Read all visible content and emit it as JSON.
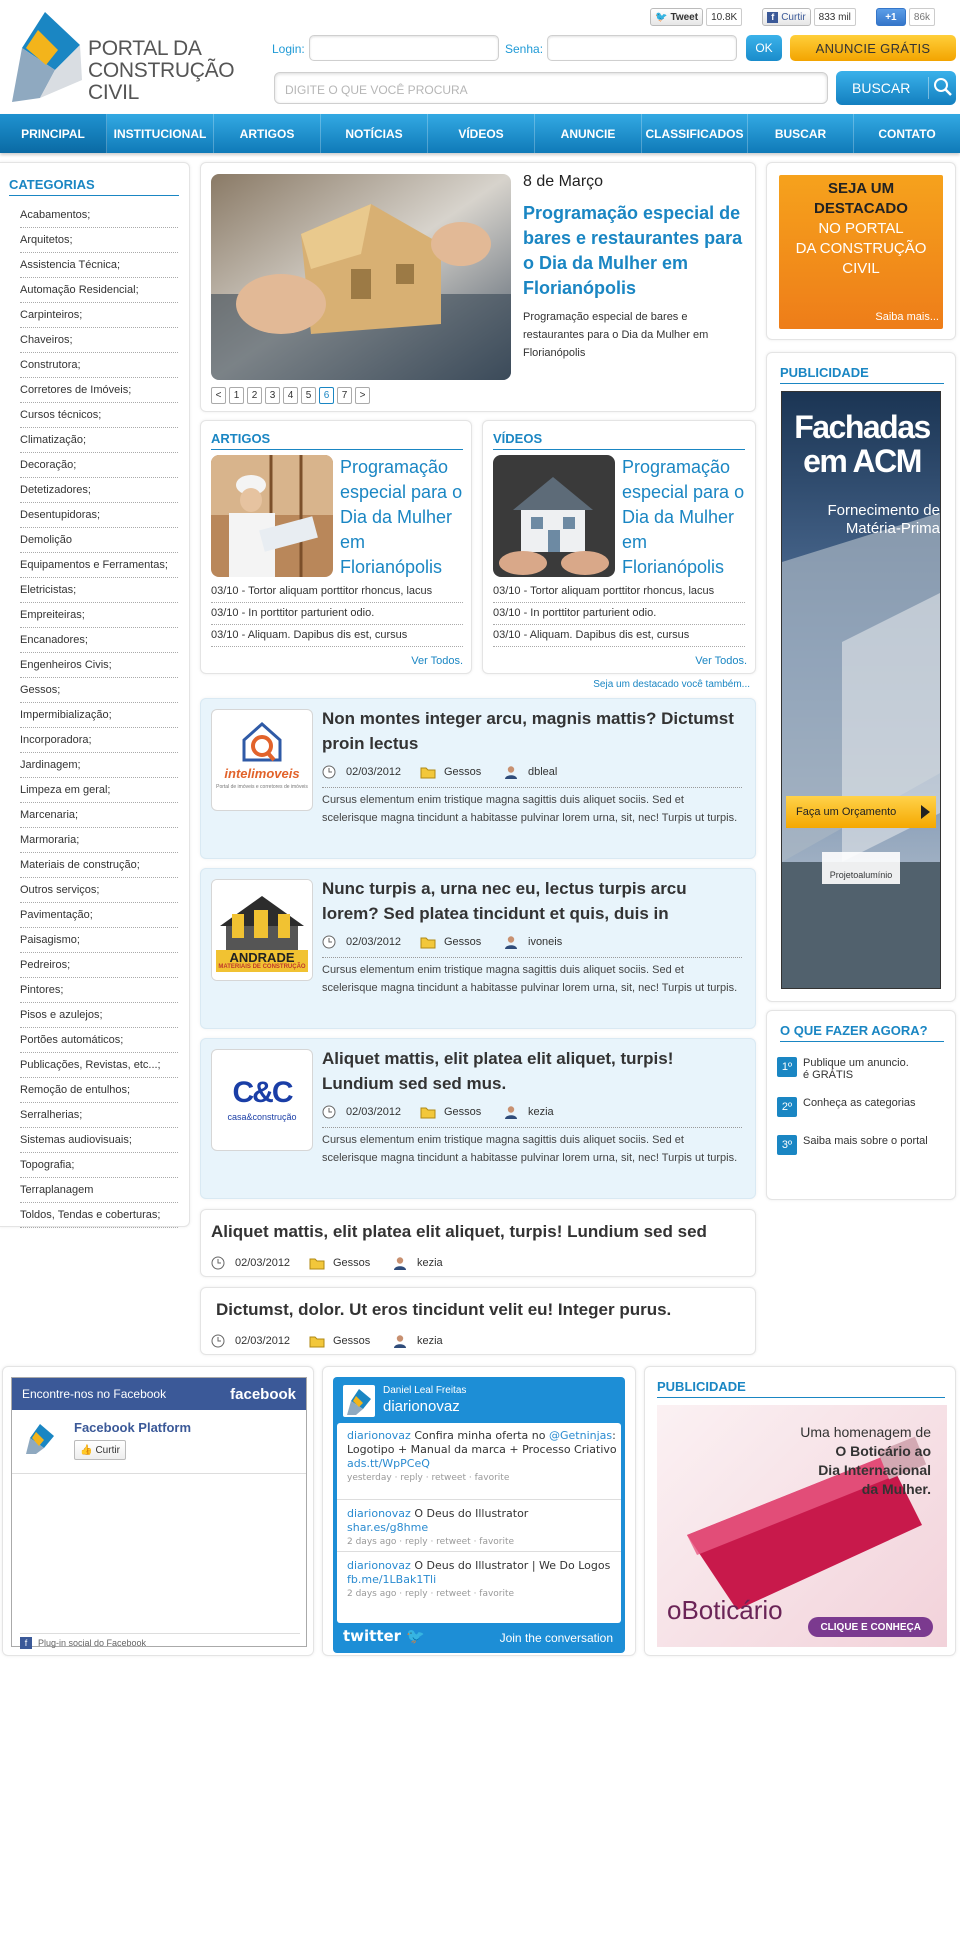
{
  "brand": {
    "logo_line1": "PORTAL DA",
    "logo_line2": "CONSTRUÇÃO CIVIL"
  },
  "social": {
    "tweet_label": "Tweet",
    "tweet_count": "10.8K",
    "curtir_label": "Curtir",
    "curtir_count": "833 mil",
    "plusone_label": "+1",
    "plusone_count": "86k"
  },
  "header": {
    "login_label": "Login:",
    "senha_label": "Senha:",
    "ok_label": "OK",
    "anuncie_label": "ANUNCIE GRÁTIS",
    "search_placeholder": "DIGITE O QUE VOCÊ PROCURA",
    "search_button": "BUSCAR"
  },
  "nav": [
    "PRINCIPAL",
    "INSTITUCIONAL",
    "ARTIGOS",
    "NOTÍCIAS",
    "VÍDEOS",
    "ANUNCIE",
    "CLASSIFICADOS",
    "BUSCAR",
    "CONTATO"
  ],
  "categories": {
    "title": "CATEGORIAS",
    "items": [
      "Acabamentos;",
      "Arquitetos;",
      "Assistencia Técnica;",
      "Automação Residencial;",
      "Carpinteiros;",
      "Chaveiros;",
      "Construtora;",
      "Corretores de Imóveis;",
      "Cursos técnicos;",
      "Climatização;",
      "Decoração;",
      "Detetizadores;",
      "Desentupidoras;",
      "Demolição",
      "Equipamentos e Ferramentas;",
      "Eletricistas;",
      "Empreiteiras;",
      "Encanadores;",
      "Engenheiros Civis;",
      "Gessos;",
      "Impermibialização;",
      "Incorporadora;",
      "Jardinagem;",
      "Limpeza em geral;",
      "Marcenaria;",
      "Marmoraria;",
      "Materiais de construção;",
      "Outros serviços;",
      "Pavimentação;",
      "Paisagismo;",
      "Pedreiros;",
      "Pintores;",
      "Pisos e azulejos;",
      "Portões automáticos;",
      "Publicações, Revistas, etc...;",
      "Remoção de entulhos;",
      "Serralherias;",
      "Sistemas audiovisuais;",
      "Topografia;",
      "Terraplanagem",
      "Toldos, Tendas e coberturas;"
    ]
  },
  "featured": {
    "date": "8 de Março",
    "title": "Programação especial de bares e restaurantes para o Dia da Mulher em Florianópolis",
    "summary": "Programação especial de bares e restaurantes para o Dia da Mulher em Florianópolis",
    "pages": [
      "<",
      "1",
      "2",
      "3",
      "4",
      "5",
      "6",
      "7",
      ">"
    ],
    "current_page": "6"
  },
  "artigos": {
    "title": "ARTIGOS",
    "headline": "Programação especial para o Dia da Mulher em Florianópolis",
    "items": [
      "03/10 - Tortor aliquam porttitor rhoncus, lacus",
      "03/10 - In porttitor parturient odio.",
      "03/10 - Aliquam. Dapibus dis est, cursus"
    ],
    "more": "Ver Todos."
  },
  "videos": {
    "title": "VÍDEOS",
    "headline": "Programação especial para o Dia da Mulher em Florianópolis",
    "items": [
      "03/10 - Tortor aliquam porttitor rhoncus, lacus",
      "03/10 - In porttitor parturient odio.",
      "03/10 - Aliquam. Dapibus dis est, cursus"
    ],
    "more": "Ver Todos."
  },
  "destacado_link": "Seja um destacado você também...",
  "posts": [
    {
      "title": "Non montes integer arcu, magnis mattis? Dictumst proin lectus",
      "date": "02/03/2012",
      "category": "Gessos",
      "author": "dbleal",
      "text": "Cursus elementum enim tristique magna sagittis duis aliquet sociis. Sed et scelerisque magna tincidunt a habitasse pulvinar lorem urna, sit, nec! Turpis ut turpis.",
      "logo_text": "intelimoveis",
      "logo_sub": "Portal de imóveis e corretores de imóveis"
    },
    {
      "title": "Nunc turpis a, urna nec eu, lectus turpis arcu lorem? Sed platea tincidunt et quis, duis in",
      "date": "02/03/2012",
      "category": "Gessos",
      "author": "ivoneis",
      "text": "Cursus elementum enim tristique magna sagittis duis aliquet sociis. Sed et scelerisque magna tincidunt a habitasse pulvinar lorem urna, sit, nec! Turpis ut turpis.",
      "logo_text": "ANDRADE",
      "logo_sub": "MATERIAIS DE CONSTRUÇÃO"
    },
    {
      "title": "Aliquet mattis, elit platea elit aliquet, turpis! Lundium sed sed mus.",
      "date": "02/03/2012",
      "category": "Gessos",
      "author": "kezia",
      "text": "Cursus elementum enim tristique magna sagittis duis aliquet sociis. Sed et scelerisque magna tincidunt a habitasse pulvinar lorem urna, sit, nec! Turpis ut turpis.",
      "logo_text": "C&C",
      "logo_sub": "casa&construção"
    }
  ],
  "simple_posts": [
    {
      "title": "Aliquet mattis, elit platea elit aliquet, turpis! Lundium sed sed",
      "date": "02/03/2012",
      "category": "Gessos",
      "author": "kezia"
    },
    {
      "title": "Dictumst, dolor. Ut eros tincidunt velit eu! Integer purus.",
      "date": "02/03/2012",
      "category": "Gessos",
      "author": "kezia"
    }
  ],
  "right": {
    "destacado": {
      "line1": "SEJA UM",
      "line2": "DESTACADO",
      "line3": "NO PORTAL",
      "line4": "DA CONSTRUÇÃO",
      "line5": "CIVIL",
      "more": "Saiba mais..."
    },
    "publicidade_title": "PUBLICIDADE",
    "ad1": {
      "headline1": "Fachadas",
      "headline2": "em ACM",
      "sub1": "Fornecimento de",
      "sub2": "Matéria-Prima",
      "cta": "Faça um Orçamento",
      "brand": "Projetoalumínio"
    },
    "oque_title": "O QUE FAZER AGORA?",
    "oque": [
      {
        "num": "1º",
        "line1": "Publique um anuncio.",
        "line2": "é GRÁTIS"
      },
      {
        "num": "2º",
        "line1": "Conheça as categorias",
        "line2": ""
      },
      {
        "num": "3º",
        "line1": "Saiba mais sobre o portal",
        "line2": ""
      }
    ]
  },
  "facebook": {
    "header": "Encontre-nos no Facebook",
    "brand": "facebook",
    "page_name": "Facebook Platform",
    "like": "Curtir",
    "footer": "Plug-in social do Facebook"
  },
  "twitter": {
    "user_name": "Daniel Leal Freitas",
    "handle": "diarionovaz",
    "tweets": [
      {
        "user": "diarionovaz",
        "text": " Confira minha oferta no ",
        "mention": "@Getninjas",
        "text2": ": Logotipo + Manual da marca + Processo Criativo ",
        "link": "ads.tt/WpPCeQ",
        "meta": "yesterday · reply · retweet · favorite"
      },
      {
        "user": "diarionovaz",
        "text": " O Deus do Illustrator ",
        "mention": "",
        "text2": "",
        "link": "shar.es/g8hme",
        "meta": "2 days ago · reply · retweet · favorite"
      },
      {
        "user": "diarionovaz",
        "text": " O Deus do Illustrator | We Do Logos ",
        "mention": "",
        "text2": "",
        "link": "fb.me/1LBak1Tli",
        "meta": "2 days ago · reply · retweet · favorite"
      }
    ],
    "footer_brand": "twitter",
    "join": "Join the conversation"
  },
  "pub2": {
    "title": "PUBLICIDADE",
    "line1": "Uma homenagem de",
    "line2": "O Boticário ao",
    "line3": "Dia Internacional",
    "line4": "da Mulher.",
    "brand": "oBoticário",
    "cta": "CLIQUE E CONHEÇA"
  }
}
